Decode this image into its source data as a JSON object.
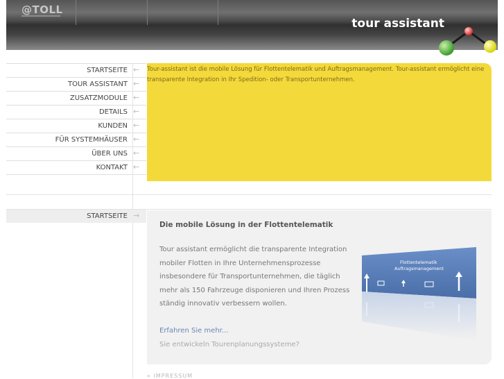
{
  "header": {
    "logo_text": "@TOLL",
    "title": "tour assistant"
  },
  "nav": {
    "arrow": "←",
    "items": [
      {
        "label": "STARTSEITE"
      },
      {
        "label": "TOUR ASSISTANT"
      },
      {
        "label": "ZUSATZMODULE"
      },
      {
        "label": "DETAILS"
      },
      {
        "label": "KUNDEN"
      },
      {
        "label": "FÜR SYSTEMHÄUSER"
      },
      {
        "label": "ÜBER UNS"
      },
      {
        "label": "KONTAKT"
      }
    ]
  },
  "intro": {
    "text": "Tour-assistant ist die mobile Lösung für Flottentelematik und Auftragsmanagement. Tour-assistant ermöglicht eine transparente Integration in Ihr Spedition- oder Transportunternehmen."
  },
  "section_nav": {
    "label": "STARTSEITE",
    "arrow": "→"
  },
  "card": {
    "title": "Die mobile Lösung in der Flottentelematik",
    "body": "Tour assistant ermöglicht die transparente Integration mobiler Flotten in Ihre Unternehmensprozesse insbesondere für Transportunternehmen, die täglich mehr als 150 Fahrzeuge disponieren und Ihren Prozess ständig innovativ verbessern wollen.",
    "link_more": "Erfahren Sie mehr...",
    "link_dev": "Sie entwickeln Tourenplanungssysteme?"
  },
  "promo": {
    "line1": "Flottentelematik",
    "line2": "Auftragsmanagement"
  },
  "footer": {
    "impressum": "» IMPRESSUM"
  },
  "colors": {
    "accent_yellow": "#f4d93a",
    "ball_green": "#4caf3a",
    "ball_red": "#e63a3a",
    "ball_yellow": "#e8e21a",
    "promo_blue": "#5479b4"
  }
}
